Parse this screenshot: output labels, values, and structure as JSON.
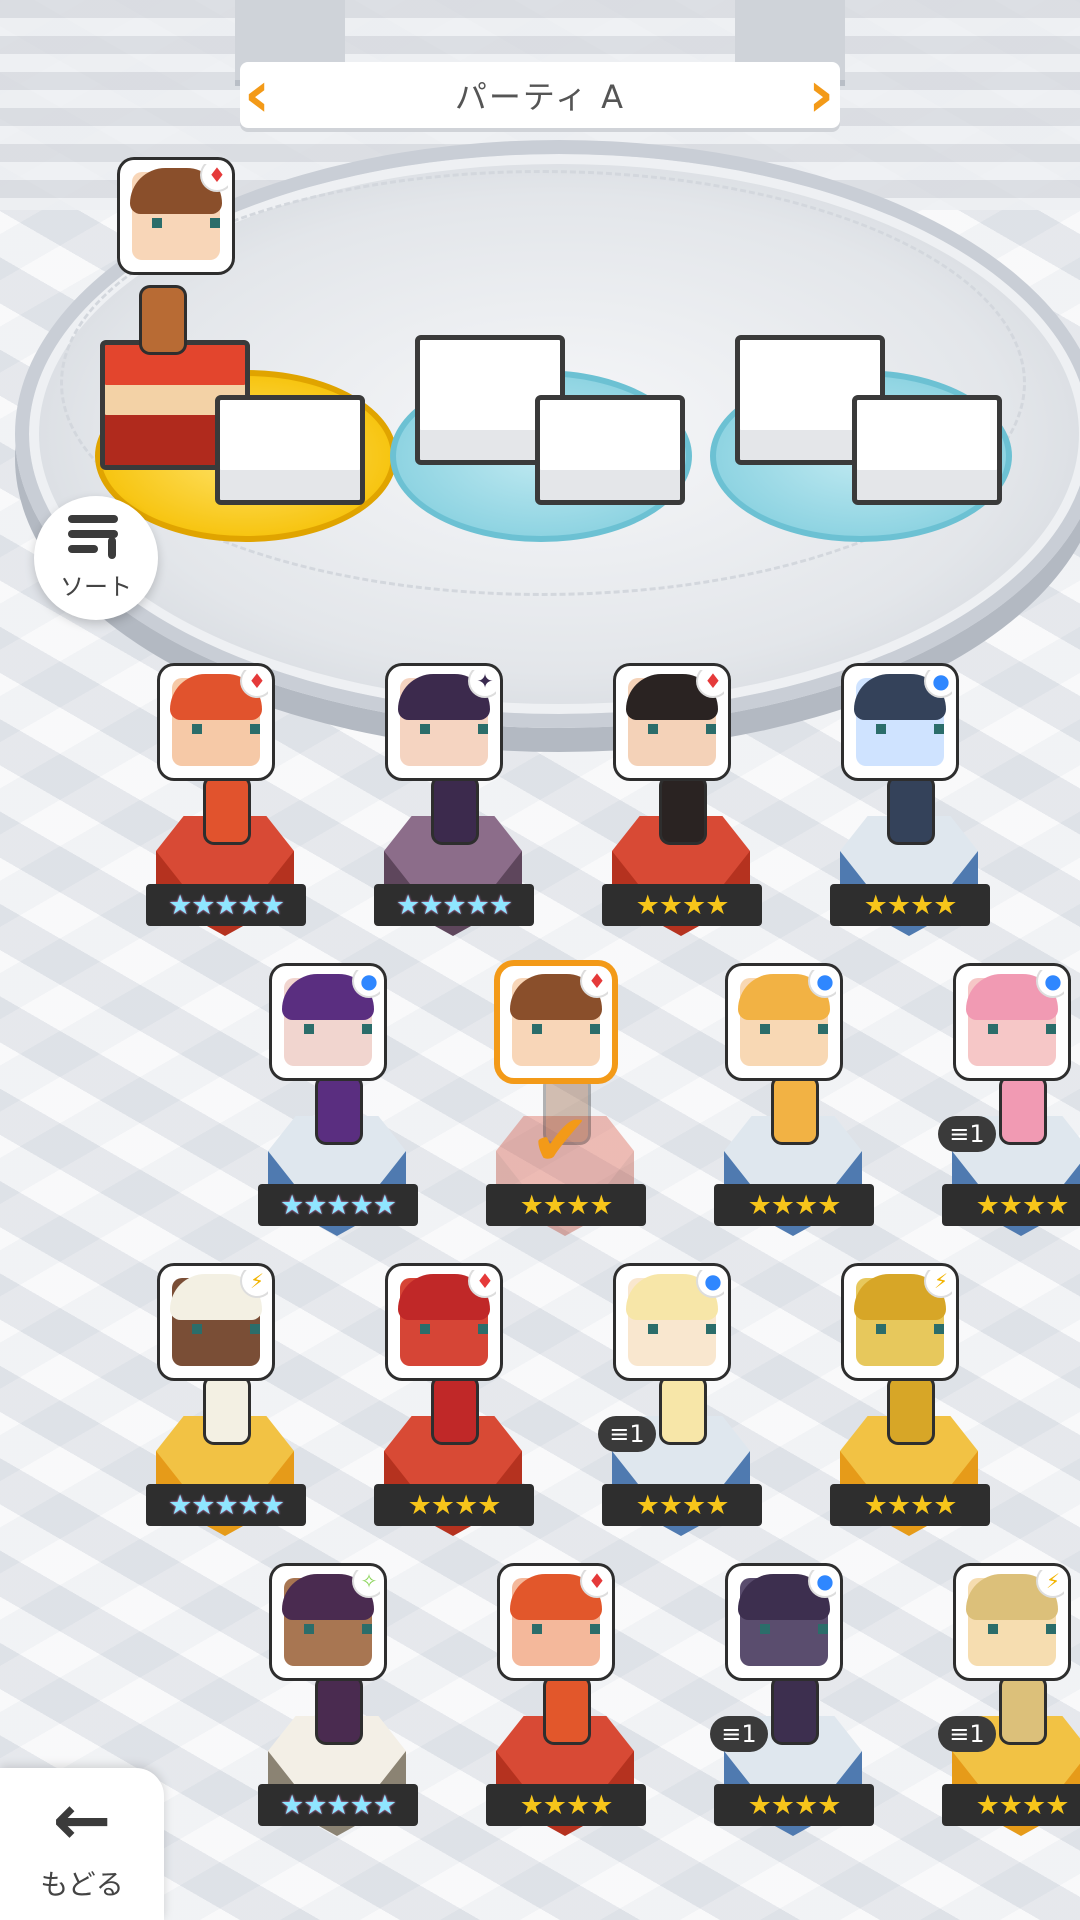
{
  "party": {
    "title": "パーティ A"
  },
  "buttons": {
    "sort_label": "ソート",
    "back_label": "もどる"
  },
  "icons": {
    "left_arrow": "chevron-left-icon",
    "right_arrow": "chevron-right-icon",
    "sort": "sort-icon",
    "back": "back-arrow-icon",
    "check": "checkmark-icon"
  },
  "colors": {
    "accent": "#f39a18",
    "star_gold": "#f7c51a",
    "badge_bg": "#2e2e2e"
  },
  "roster": [
    {
      "stars": "★★★★★",
      "rarity": "rainbow",
      "element": "fire"
    },
    {
      "stars": "★★★★★",
      "rarity": "rainbow",
      "element": "dark"
    },
    {
      "stars": "★★★★",
      "rarity": "gold",
      "element": "fire"
    },
    {
      "stars": "★★★★",
      "rarity": "gold",
      "element": "water"
    },
    {
      "stars": "★★★★★",
      "rarity": "rainbow",
      "element": "water"
    },
    {
      "stars": "★★★★",
      "rarity": "gold",
      "element": "fire",
      "selected": true
    },
    {
      "stars": "★★★★",
      "rarity": "gold",
      "element": "water"
    },
    {
      "stars": "★★★★",
      "rarity": "gold",
      "element": "water",
      "count": "1"
    },
    {
      "stars": "★★★★★",
      "rarity": "rainbow",
      "element": "thunder"
    },
    {
      "stars": "★★★★",
      "rarity": "gold",
      "element": "fire"
    },
    {
      "stars": "★★★★",
      "rarity": "gold",
      "element": "water",
      "count": "1"
    },
    {
      "stars": "★★★★",
      "rarity": "gold",
      "element": "thunder"
    },
    {
      "stars": "★★★★★",
      "rarity": "rainbow",
      "element": "light"
    },
    {
      "stars": "★★★★",
      "rarity": "gold",
      "element": "fire"
    },
    {
      "stars": "★★★★",
      "rarity": "gold",
      "element": "water",
      "count": "1"
    },
    {
      "stars": "★★★★",
      "rarity": "gold",
      "element": "thunder",
      "count": "1"
    }
  ]
}
